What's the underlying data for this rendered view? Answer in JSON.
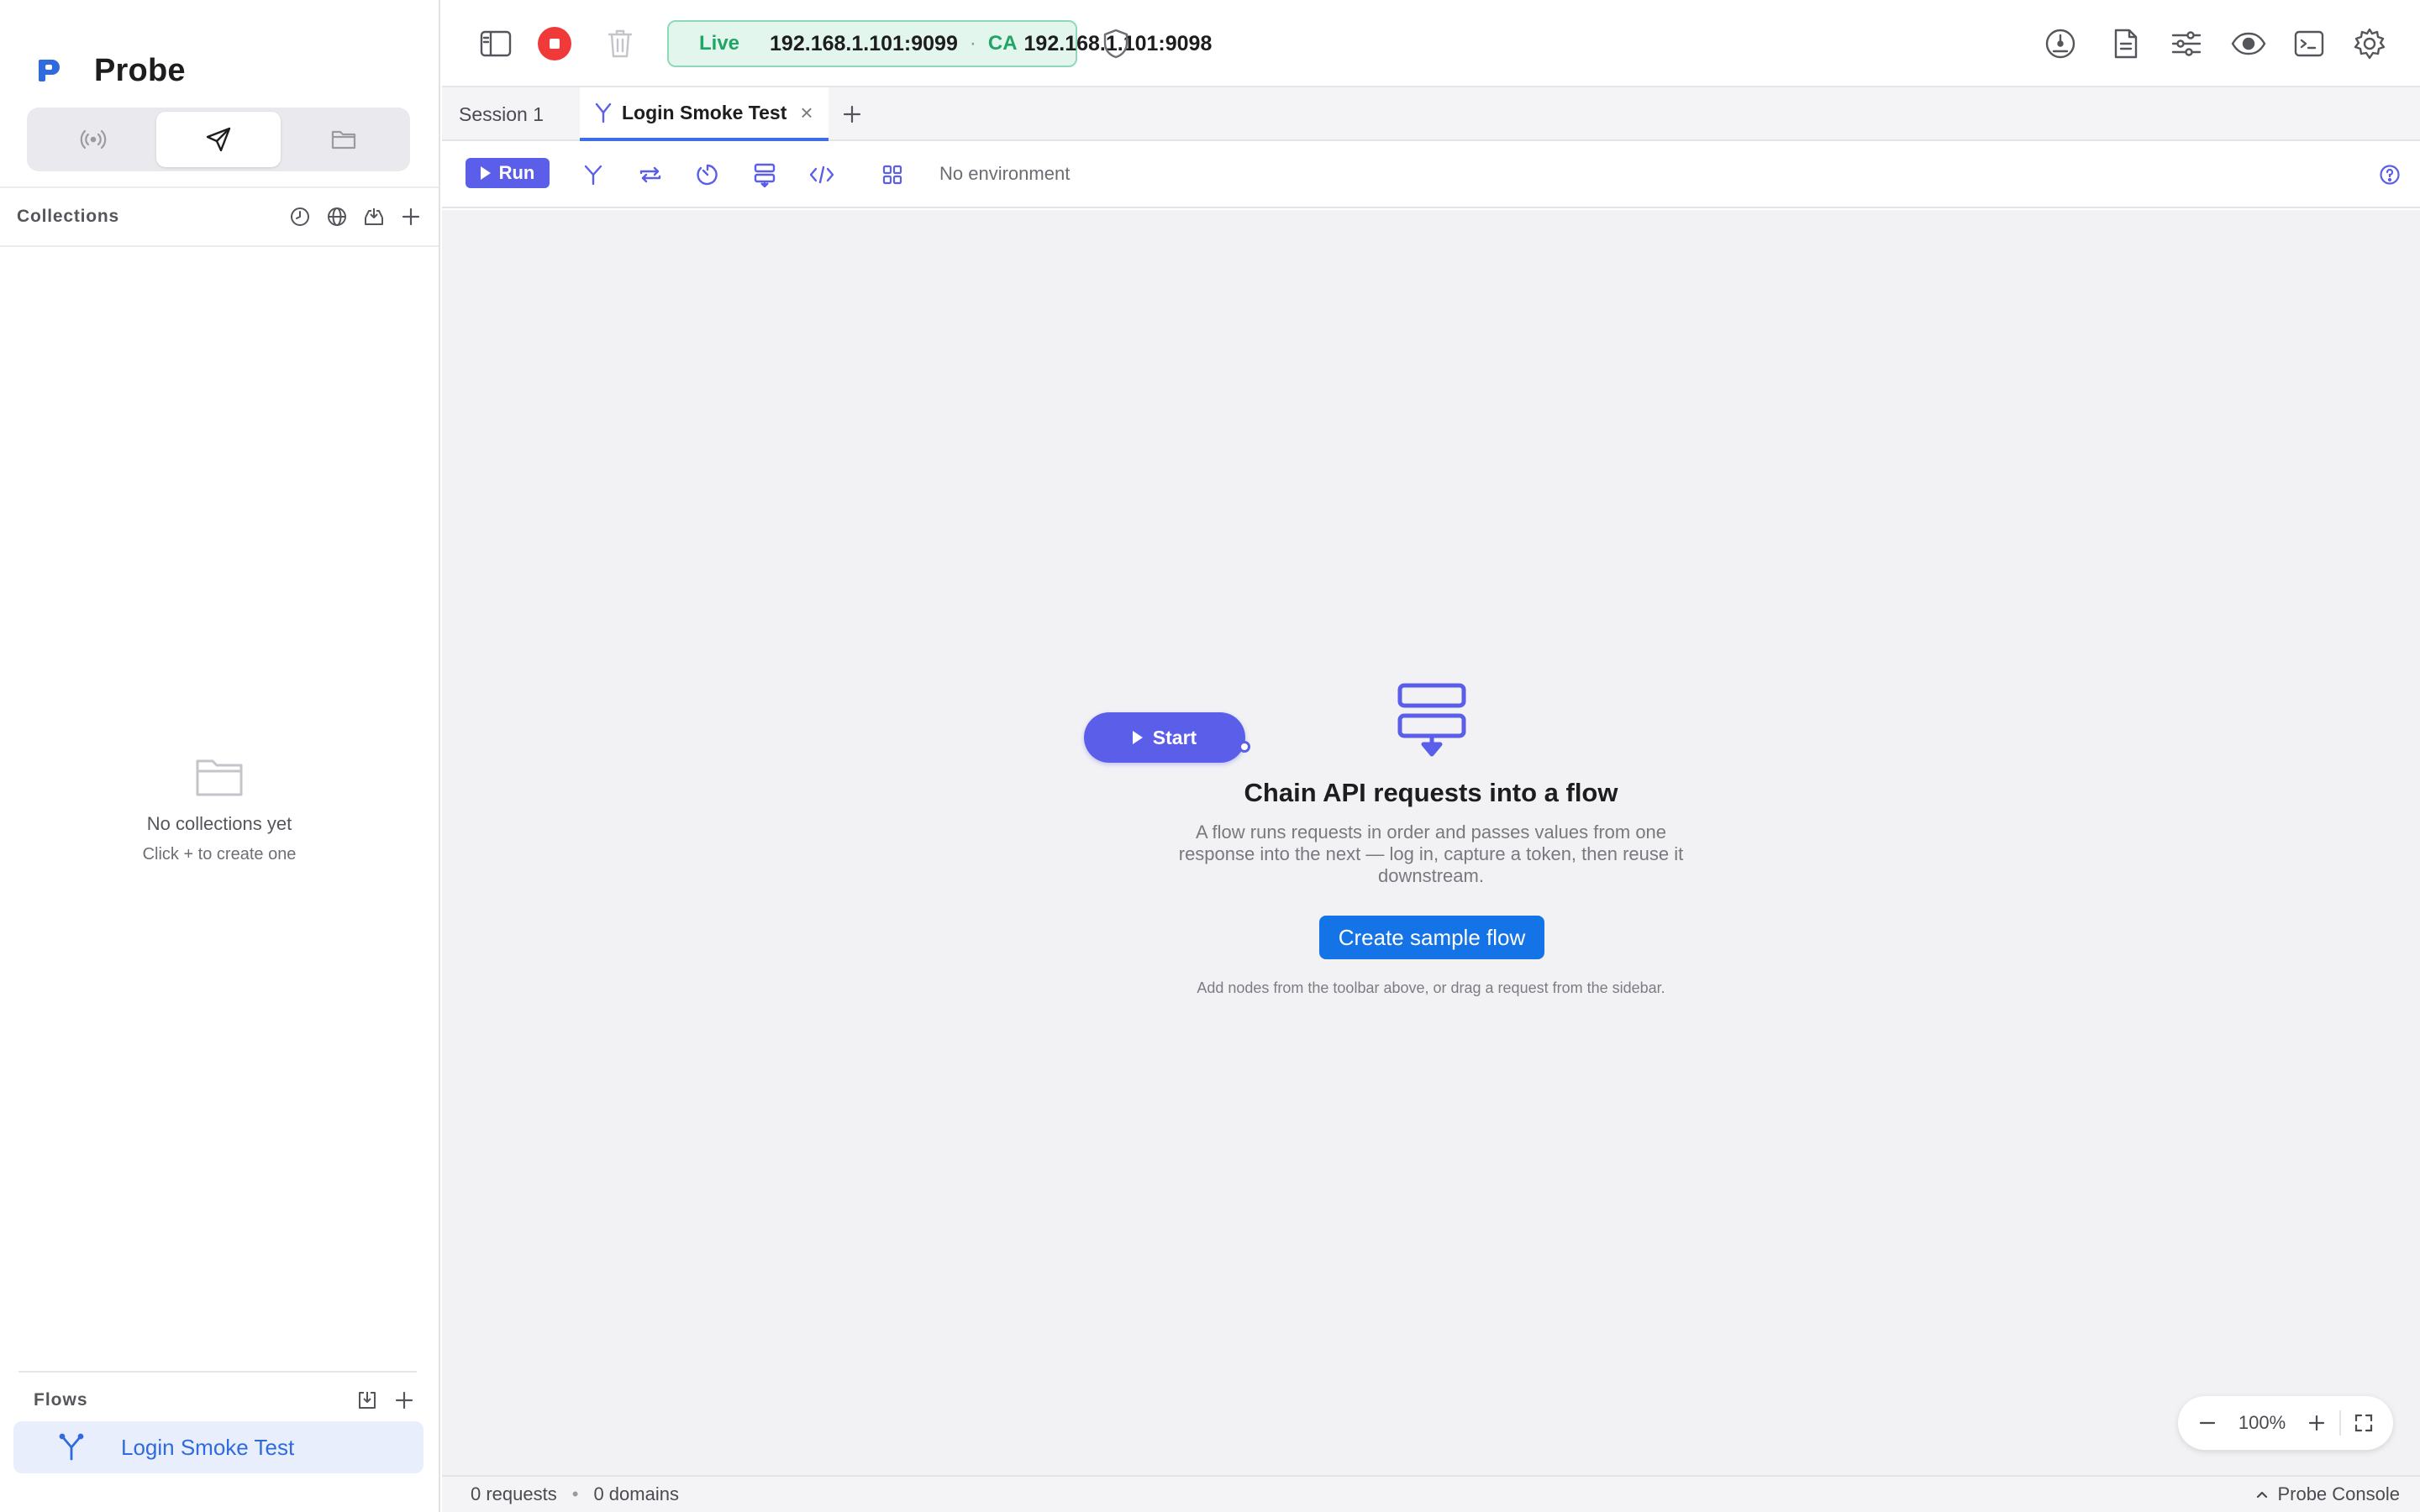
{
  "app": {
    "name": "Probe"
  },
  "sidebar": {
    "modes": [
      {
        "icon": "broadcast-icon"
      },
      {
        "icon": "send-icon",
        "active": true
      },
      {
        "icon": "folder-icon"
      }
    ],
    "collections": {
      "title": "Collections",
      "actions": [
        "history-icon",
        "globe-icon",
        "import-icon",
        "plus-icon"
      ],
      "empty_title": "No collections yet",
      "empty_hint": "Click + to create one"
    },
    "flows": {
      "title": "Flows",
      "actions": [
        "import-icon",
        "plus-icon"
      ],
      "items": [
        {
          "label": "Login Smoke Test",
          "active": true
        }
      ]
    }
  },
  "topbar": {
    "live": {
      "status": "Live",
      "address": "192.168.1.101:9099",
      "separator": "·",
      "ca_label": "CA",
      "ca_address": "192.168.1.101:9098"
    },
    "right_icons": [
      "gauge-icon",
      "document-icon",
      "sliders-icon",
      "eye-icon",
      "terminal-icon",
      "gear-icon"
    ]
  },
  "tabs": [
    {
      "label": "Session 1"
    },
    {
      "label": "Login Smoke Test",
      "active": true,
      "close": "×"
    }
  ],
  "flow_toolbar": {
    "run_label": "Run",
    "environment": "No environment"
  },
  "canvas": {
    "start_label": "Start",
    "heading": "Chain API requests into a flow",
    "description": "A flow runs requests in order and passes values from one response into the next — log in, capture a token, then reuse it downstream.",
    "cta": "Create sample flow",
    "hint": "Add nodes from the toolbar above, or drag a request from the sidebar.",
    "zoom": "100%"
  },
  "status": {
    "requests": "0 requests",
    "separator": "•",
    "domains": "0 domains",
    "console": "Probe Console"
  },
  "colors": {
    "accent": "#5b5ee8",
    "primary_button": "#1473e6",
    "live_green": "#1fa565",
    "stop_red": "#f03a3a"
  }
}
